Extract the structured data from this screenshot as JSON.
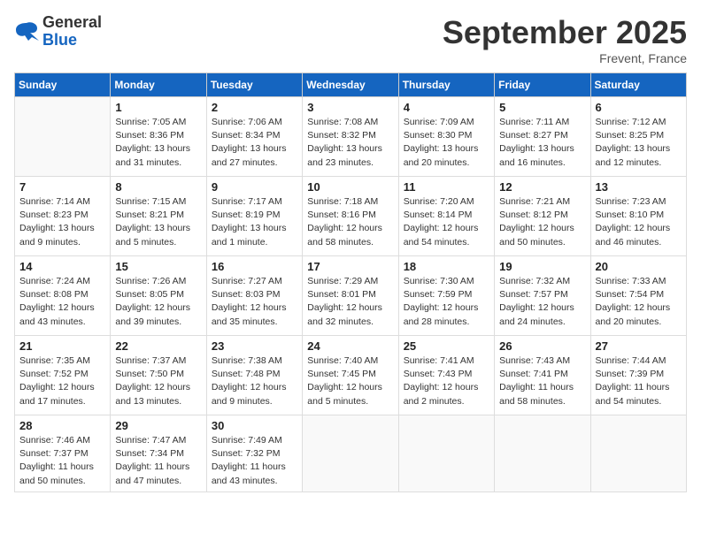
{
  "header": {
    "logo_general": "General",
    "logo_blue": "Blue",
    "month_title": "September 2025",
    "location": "Frevent, France"
  },
  "days_of_week": [
    "Sunday",
    "Monday",
    "Tuesday",
    "Wednesday",
    "Thursday",
    "Friday",
    "Saturday"
  ],
  "weeks": [
    [
      {
        "day": "",
        "info": ""
      },
      {
        "day": "1",
        "info": "Sunrise: 7:05 AM\nSunset: 8:36 PM\nDaylight: 13 hours\nand 31 minutes."
      },
      {
        "day": "2",
        "info": "Sunrise: 7:06 AM\nSunset: 8:34 PM\nDaylight: 13 hours\nand 27 minutes."
      },
      {
        "day": "3",
        "info": "Sunrise: 7:08 AM\nSunset: 8:32 PM\nDaylight: 13 hours\nand 23 minutes."
      },
      {
        "day": "4",
        "info": "Sunrise: 7:09 AM\nSunset: 8:30 PM\nDaylight: 13 hours\nand 20 minutes."
      },
      {
        "day": "5",
        "info": "Sunrise: 7:11 AM\nSunset: 8:27 PM\nDaylight: 13 hours\nand 16 minutes."
      },
      {
        "day": "6",
        "info": "Sunrise: 7:12 AM\nSunset: 8:25 PM\nDaylight: 13 hours\nand 12 minutes."
      }
    ],
    [
      {
        "day": "7",
        "info": "Sunrise: 7:14 AM\nSunset: 8:23 PM\nDaylight: 13 hours\nand 9 minutes."
      },
      {
        "day": "8",
        "info": "Sunrise: 7:15 AM\nSunset: 8:21 PM\nDaylight: 13 hours\nand 5 minutes."
      },
      {
        "day": "9",
        "info": "Sunrise: 7:17 AM\nSunset: 8:19 PM\nDaylight: 13 hours\nand 1 minute."
      },
      {
        "day": "10",
        "info": "Sunrise: 7:18 AM\nSunset: 8:16 PM\nDaylight: 12 hours\nand 58 minutes."
      },
      {
        "day": "11",
        "info": "Sunrise: 7:20 AM\nSunset: 8:14 PM\nDaylight: 12 hours\nand 54 minutes."
      },
      {
        "day": "12",
        "info": "Sunrise: 7:21 AM\nSunset: 8:12 PM\nDaylight: 12 hours\nand 50 minutes."
      },
      {
        "day": "13",
        "info": "Sunrise: 7:23 AM\nSunset: 8:10 PM\nDaylight: 12 hours\nand 46 minutes."
      }
    ],
    [
      {
        "day": "14",
        "info": "Sunrise: 7:24 AM\nSunset: 8:08 PM\nDaylight: 12 hours\nand 43 minutes."
      },
      {
        "day": "15",
        "info": "Sunrise: 7:26 AM\nSunset: 8:05 PM\nDaylight: 12 hours\nand 39 minutes."
      },
      {
        "day": "16",
        "info": "Sunrise: 7:27 AM\nSunset: 8:03 PM\nDaylight: 12 hours\nand 35 minutes."
      },
      {
        "day": "17",
        "info": "Sunrise: 7:29 AM\nSunset: 8:01 PM\nDaylight: 12 hours\nand 32 minutes."
      },
      {
        "day": "18",
        "info": "Sunrise: 7:30 AM\nSunset: 7:59 PM\nDaylight: 12 hours\nand 28 minutes."
      },
      {
        "day": "19",
        "info": "Sunrise: 7:32 AM\nSunset: 7:57 PM\nDaylight: 12 hours\nand 24 minutes."
      },
      {
        "day": "20",
        "info": "Sunrise: 7:33 AM\nSunset: 7:54 PM\nDaylight: 12 hours\nand 20 minutes."
      }
    ],
    [
      {
        "day": "21",
        "info": "Sunrise: 7:35 AM\nSunset: 7:52 PM\nDaylight: 12 hours\nand 17 minutes."
      },
      {
        "day": "22",
        "info": "Sunrise: 7:37 AM\nSunset: 7:50 PM\nDaylight: 12 hours\nand 13 minutes."
      },
      {
        "day": "23",
        "info": "Sunrise: 7:38 AM\nSunset: 7:48 PM\nDaylight: 12 hours\nand 9 minutes."
      },
      {
        "day": "24",
        "info": "Sunrise: 7:40 AM\nSunset: 7:45 PM\nDaylight: 12 hours\nand 5 minutes."
      },
      {
        "day": "25",
        "info": "Sunrise: 7:41 AM\nSunset: 7:43 PM\nDaylight: 12 hours\nand 2 minutes."
      },
      {
        "day": "26",
        "info": "Sunrise: 7:43 AM\nSunset: 7:41 PM\nDaylight: 11 hours\nand 58 minutes."
      },
      {
        "day": "27",
        "info": "Sunrise: 7:44 AM\nSunset: 7:39 PM\nDaylight: 11 hours\nand 54 minutes."
      }
    ],
    [
      {
        "day": "28",
        "info": "Sunrise: 7:46 AM\nSunset: 7:37 PM\nDaylight: 11 hours\nand 50 minutes."
      },
      {
        "day": "29",
        "info": "Sunrise: 7:47 AM\nSunset: 7:34 PM\nDaylight: 11 hours\nand 47 minutes."
      },
      {
        "day": "30",
        "info": "Sunrise: 7:49 AM\nSunset: 7:32 PM\nDaylight: 11 hours\nand 43 minutes."
      },
      {
        "day": "",
        "info": ""
      },
      {
        "day": "",
        "info": ""
      },
      {
        "day": "",
        "info": ""
      },
      {
        "day": "",
        "info": ""
      }
    ]
  ]
}
